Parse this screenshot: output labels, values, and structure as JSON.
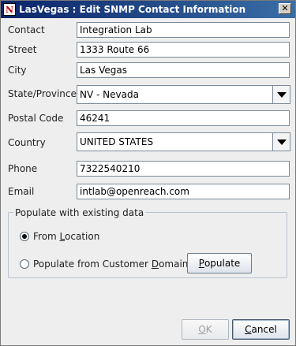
{
  "window": {
    "title": "LasVegas : Edit SNMP Contact Information",
    "icon": "app-logo-icon",
    "icon_text": "N",
    "close_icon": "close-icon",
    "close_glyph": "✕"
  },
  "form": {
    "contact": {
      "label": "Contact",
      "value": "Integration Lab"
    },
    "street": {
      "label": "Street",
      "value": "1333 Route 66"
    },
    "city": {
      "label": "City",
      "value": "Las Vegas"
    },
    "state": {
      "label": "State/Province",
      "value": "NV - Nevada"
    },
    "postal": {
      "label": "Postal Code",
      "value": "46241"
    },
    "country": {
      "label": "Country",
      "value": "UNITED STATES"
    },
    "phone": {
      "label": "Phone",
      "value": "7322540210"
    },
    "email": {
      "label": "Email",
      "value": "intlab@openreach.com"
    }
  },
  "populate_group": {
    "title": "Populate with existing data",
    "from_location": {
      "label_pre": "From ",
      "label_mnemonic": "L",
      "label_post": "ocation",
      "selected": true
    },
    "from_customer_domain": {
      "label_pre": "Populate from Customer ",
      "label_mnemonic": "D",
      "label_post": "omain",
      "selected": false
    },
    "populate_button": {
      "label_mnemonic": "P",
      "label_rest": "opulate"
    }
  },
  "buttons": {
    "ok": {
      "label_mnemonic": "O",
      "label_rest": "K",
      "enabled": false
    },
    "cancel": {
      "label_mnemonic": "C",
      "label_rest": "ancel"
    }
  }
}
